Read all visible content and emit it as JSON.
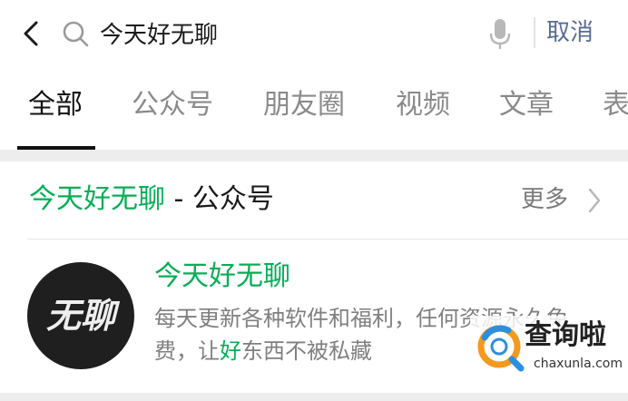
{
  "search": {
    "query": "今天好无聊",
    "cancel_label": "取消"
  },
  "tabs": [
    {
      "label": "全部",
      "active": true
    },
    {
      "label": "公众号",
      "active": false
    },
    {
      "label": "朋友圈",
      "active": false
    },
    {
      "label": "视频",
      "active": false
    },
    {
      "label": "文章",
      "active": false
    },
    {
      "label": "表",
      "active": false
    }
  ],
  "section": {
    "keyword": "今天好无聊",
    "suffix": " - 公众号",
    "more_label": "更多"
  },
  "result": {
    "name": "今天好无聊",
    "avatar_text": "无聊",
    "desc_part1": "每天更新各种软件和福利，任何资源永久免费，让",
    "desc_highlight": "好",
    "desc_part2": "东西不被私藏"
  },
  "watermark": {
    "name": "查询啦",
    "domain": "chaxunla.com"
  },
  "colors": {
    "highlight": "#06ae56",
    "link": "#576b95",
    "tab_active": "#111111",
    "tab_inactive": "#8a8a8a",
    "separator": "#ededed"
  },
  "icons": [
    "back-arrow-icon",
    "search-icon",
    "microphone-icon",
    "chevron-right-icon"
  ]
}
